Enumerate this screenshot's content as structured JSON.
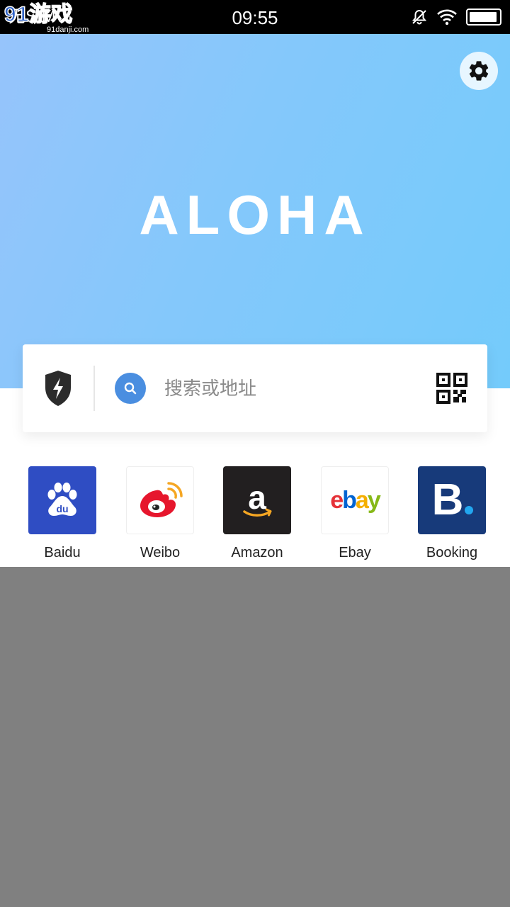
{
  "status_bar": {
    "carrier": "无SIM",
    "time": "09:55",
    "icons": [
      "bell-muted-icon",
      "wifi-icon",
      "battery-icon"
    ]
  },
  "watermark": {
    "main": "91游戏",
    "sub": "91danji.com"
  },
  "hero": {
    "logo": "ALOHA",
    "settings_icon": "gear-icon",
    "gradient": [
      "#96c4fb",
      "#74cbfb"
    ]
  },
  "search": {
    "placeholder": "搜索或地址",
    "value": "",
    "left_icon": "shield-bolt-icon",
    "search_icon": "magnifier-icon",
    "right_icon": "qr-code-icon",
    "accent": "#4a8ee0"
  },
  "quick_links": [
    {
      "label": "Baidu",
      "icon": "baidu-paw-icon",
      "color": "#2f4dc3"
    },
    {
      "label": "Weibo",
      "icon": "weibo-eye-icon",
      "color": "#e6162d"
    },
    {
      "label": "Amazon",
      "icon": "amazon-a-icon",
      "color": "#221f20"
    },
    {
      "label": "Ebay",
      "icon": "ebay-logo-icon",
      "color": "#ffffff"
    },
    {
      "label": "Booking",
      "icon": "booking-b-icon",
      "color": "#173a7a"
    }
  ]
}
